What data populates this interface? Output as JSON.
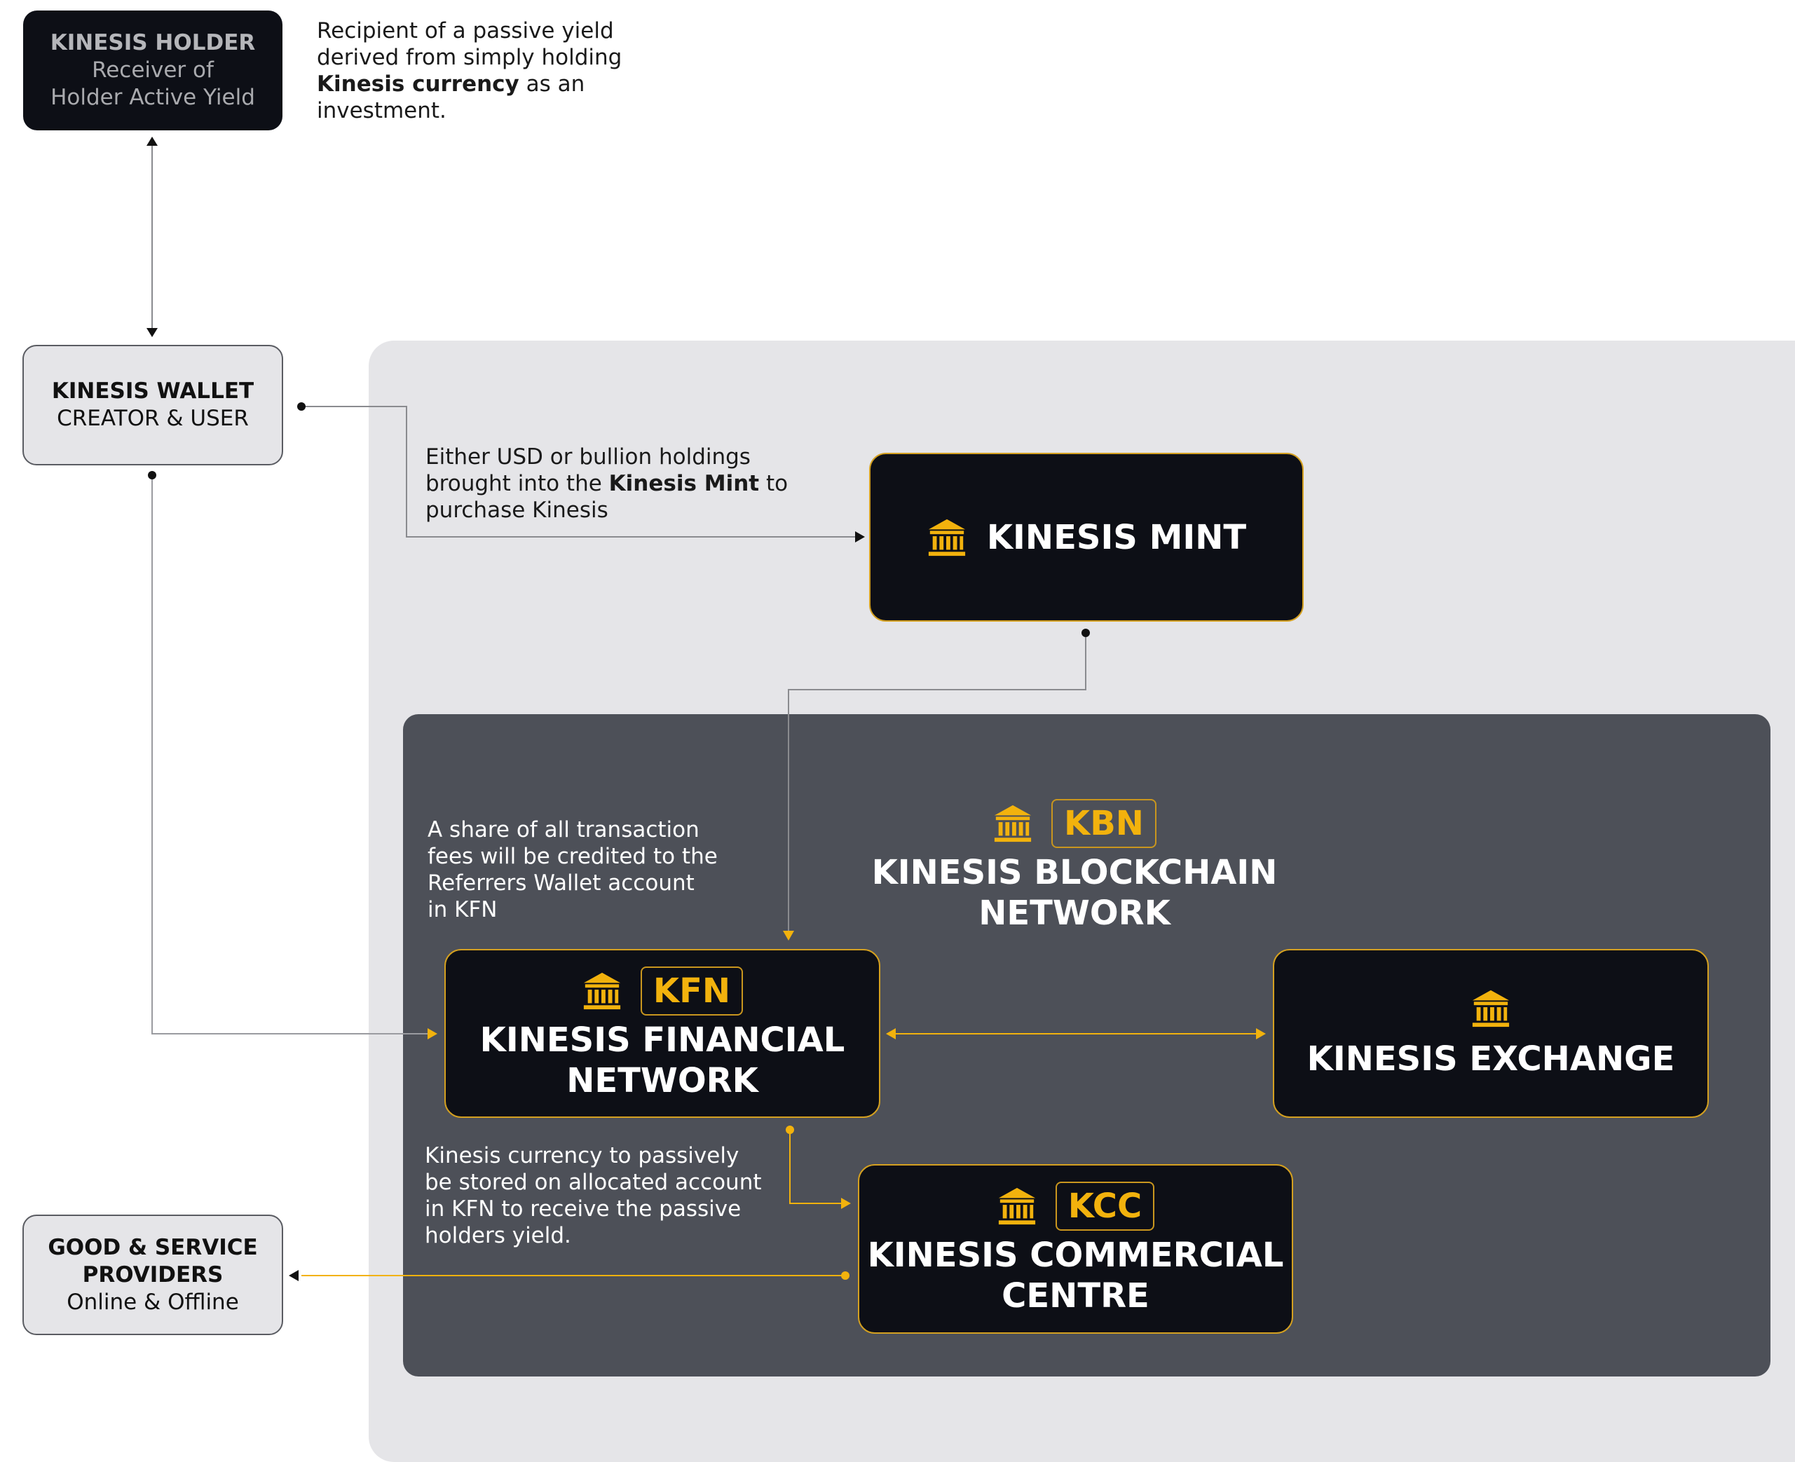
{
  "holder": {
    "title": "KINESIS HOLDER",
    "line1": "Receiver of",
    "line2": "Holder Active Yield"
  },
  "holder_note": {
    "l1": "Recipient of a passive yield",
    "l2": "derived from simply holding",
    "l3_bold": "Kinesis currency",
    "l3_rest": " as an",
    "l4": "investment."
  },
  "wallet": {
    "title": "KINESIS WALLET",
    "subtitle": "CREATOR & USER"
  },
  "providers": {
    "line1": "GOOD & SERVICE",
    "line2": "PROVIDERS",
    "line3": "Online & Offline"
  },
  "mint": {
    "title": "KINESIS MINT"
  },
  "mint_note": {
    "l1": "Either USD or bullion holdings",
    "l2_pre": "brought into the ",
    "l2_bold": "Kinesis Mint",
    "l2_post": " to",
    "l3": "purchase Kinesis"
  },
  "kbn": {
    "badge": "KBN",
    "line1": "KINESIS BLOCKCHAIN",
    "line2": "NETWORK"
  },
  "kfn": {
    "badge": "KFN",
    "line1": "KINESIS FINANCIAL",
    "line2": "NETWORK"
  },
  "exchange": {
    "title": "KINESIS EXCHANGE"
  },
  "kcc": {
    "badge": "KCC",
    "line1": "KINESIS COMMERCIAL",
    "line2": "CENTRE"
  },
  "fees_note": {
    "l1": "A share of all transaction",
    "l2": "fees will be credited to the",
    "l3": "Referrers Wallet account",
    "l4": "in KFN"
  },
  "storage_note": {
    "l1": "Kinesis currency to passively",
    "l2": "be stored on allocated account",
    "l3": "in KFN to receive the passive",
    "l4": "holders yield."
  },
  "colors": {
    "gold": "#f2b20d",
    "dark_box": "#0d0f16",
    "inner_region": "#4d5058",
    "outer_region": "#e5e5e8"
  },
  "icons": {
    "institution": "bank-icon"
  }
}
